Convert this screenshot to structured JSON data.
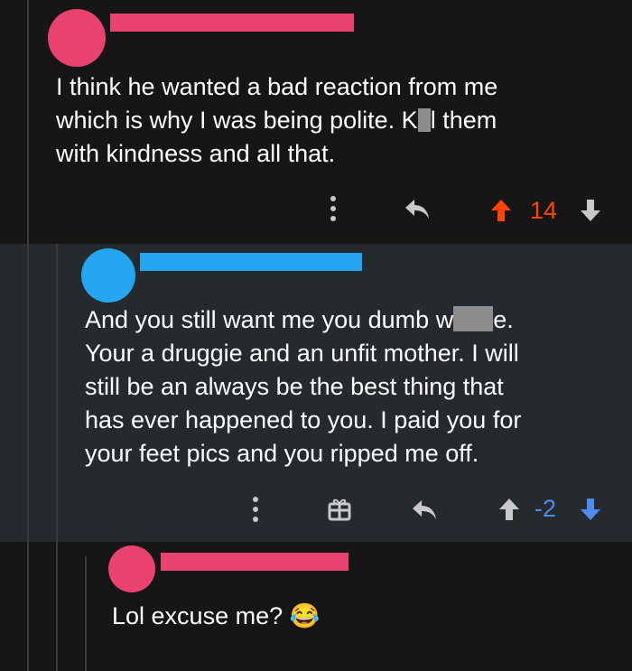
{
  "colors": {
    "background": "#161617",
    "highlight_background": "#252a2f",
    "pink": "#e9426f",
    "blue": "#24a7f0",
    "upvote_active": "#ff4500",
    "downvote_active": "#4d8bf0",
    "icon_gray": "#c9c9c9"
  },
  "comments": [
    {
      "author_redacted": true,
      "avatar_color": "#e9426f",
      "text_before": "I think he wanted a bad reaction from me\nwhich is why I was being polite. K",
      "text_after": "l them\nwith kindness and all that.",
      "score": "14",
      "vote_state": "upvoted",
      "icons": [
        "more-icon",
        "reply-icon",
        "upvote-icon",
        "downvote-icon"
      ]
    },
    {
      "author_redacted": true,
      "avatar_color": "#24a7f0",
      "text_before": "And you still want me you dumb w",
      "text_after": "e.\nYour a druggie and an unfit mother. I will\nstill be an always be the best thing that\nhas ever happened to you. I paid you for\nyour feet pics and you ripped me off.",
      "score": "-2",
      "vote_state": "downvoted",
      "icons": [
        "more-icon",
        "gift-icon",
        "reply-icon",
        "upvote-icon",
        "downvote-icon"
      ]
    },
    {
      "author_redacted": true,
      "avatar_color": "#e9426f",
      "text": "Lol excuse me?",
      "emoji": "😂"
    }
  ]
}
